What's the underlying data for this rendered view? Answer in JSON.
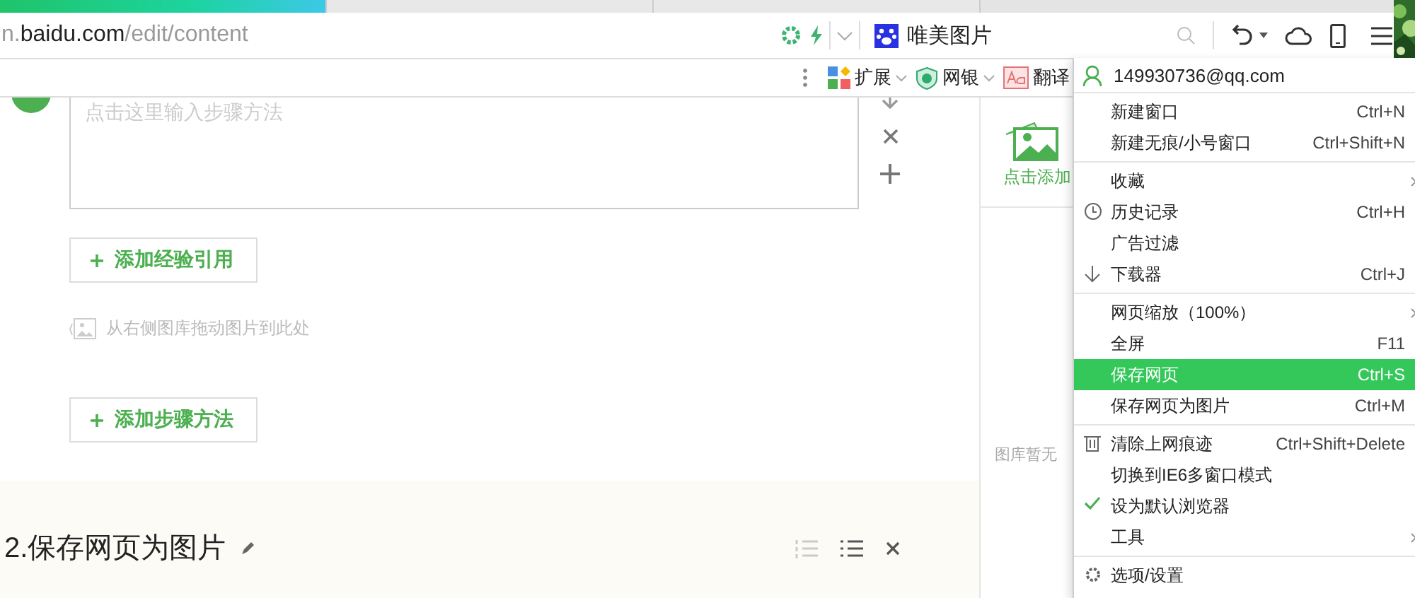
{
  "tabs": [
    {
      "selected": true
    },
    {
      "selected": false
    },
    {
      "selected": false
    }
  ],
  "address_bar": {
    "url": [
      {
        "text": "n.",
        "strong": false
      },
      {
        "text": "baidu.com",
        "strong": true
      },
      {
        "text": "/edit/content",
        "strong": false
      }
    ],
    "search_value": "唯美图片"
  },
  "bookmarks": [
    {
      "label": "扩展",
      "kind": "extensions"
    },
    {
      "label": "网银",
      "kind": "bank"
    },
    {
      "label": "翻译",
      "kind": "translate"
    }
  ],
  "editor": {
    "step_placeholder": "点击这里输入步骤方法",
    "buttons": [
      "添加经验引用"
    ],
    "image_hint": "从右侧图库拖动图片到此处",
    "add_step": "添加步骤方法",
    "next_step_title": "2.保存网页为图片"
  },
  "gallery": {
    "add_label": "点击添加",
    "empty_text": "图库暂无"
  },
  "menu": {
    "account": "149930736@qq.com",
    "groups": [
      [
        {
          "label": "新建窗口",
          "shortcut": "Ctrl+N",
          "kind": "plain",
          "submenu": false,
          "selected": false,
          "checked": false
        },
        {
          "label": "新建无痕/小号窗口",
          "shortcut": "Ctrl+Shift+N",
          "kind": "plain",
          "submenu": false,
          "selected": false,
          "checked": false
        }
      ],
      [
        {
          "label": "收藏",
          "kind": "plain",
          "submenu": true,
          "selected": false,
          "checked": false
        },
        {
          "label": "历史记录",
          "shortcut": "Ctrl+H",
          "kind": "clock",
          "submenu": false,
          "selected": false,
          "checked": false
        },
        {
          "label": "广告过滤",
          "kind": "plain",
          "submenu": false,
          "selected": false,
          "checked": false
        },
        {
          "label": "下载器",
          "shortcut": "Ctrl+J",
          "kind": "download",
          "submenu": false,
          "selected": false,
          "checked": false
        }
      ],
      [
        {
          "label": "网页缩放（100%）",
          "kind": "plain",
          "submenu": true,
          "selected": false,
          "checked": false
        },
        {
          "label": "全屏",
          "shortcut": "F11",
          "kind": "plain",
          "submenu": false,
          "selected": false,
          "checked": false
        },
        {
          "label": "保存网页",
          "shortcut": "Ctrl+S",
          "kind": "plain",
          "submenu": false,
          "selected": true,
          "checked": false
        },
        {
          "label": "保存网页为图片",
          "shortcut": "Ctrl+M",
          "kind": "plain",
          "submenu": false,
          "selected": false,
          "checked": false
        }
      ],
      [
        {
          "label": "清除上网痕迹",
          "shortcut": "Ctrl+Shift+Delete",
          "kind": "trash",
          "submenu": false,
          "selected": false,
          "checked": false
        },
        {
          "label": "切换到IE6多窗口模式",
          "kind": "plain",
          "submenu": false,
          "selected": false,
          "checked": false
        },
        {
          "label": "设为默认浏览器",
          "kind": "plain",
          "submenu": false,
          "selected": false,
          "checked": true
        },
        {
          "label": "工具",
          "kind": "plain",
          "submenu": true,
          "selected": false,
          "checked": false
        }
      ],
      [
        {
          "label": "选项/设置",
          "kind": "gear",
          "submenu": false,
          "selected": false,
          "checked": false
        }
      ]
    ]
  }
}
